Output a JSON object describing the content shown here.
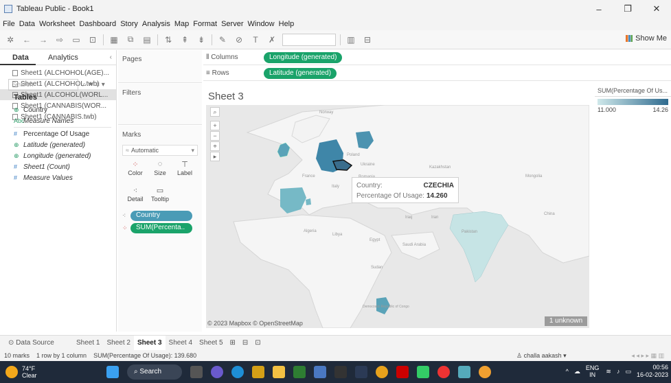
{
  "window": {
    "title": "Tableau Public - Book1",
    "controls": [
      "–",
      "❐",
      "✕"
    ]
  },
  "menu": [
    "File",
    "Data",
    "Worksheet",
    "Dashboard",
    "Story",
    "Analysis",
    "Map",
    "Format",
    "Server",
    "Window",
    "Help"
  ],
  "toolbar": {
    "show_me": "Show Me"
  },
  "data_pane": {
    "tabs": [
      "Data",
      "Analytics"
    ],
    "sources": [
      "Sheet1 (ALCHOHOL(AGE)...",
      "Sheet1 (ALCHOHOL.twb)",
      "Sheet1 (ALCOHOL(WORL...",
      "Sheet1 (CANNABIS(WOR...",
      "Sheet1 (CANNABIS.twb)"
    ],
    "selected_source": 2,
    "search_placeholder": "Search",
    "tables_label": "Tables",
    "fields": [
      {
        "icon": "⊕",
        "label": "Country",
        "kind": "dim",
        "italic": false
      },
      {
        "icon": "Abc",
        "label": "Measure Names",
        "kind": "dim",
        "italic": true
      },
      {
        "icon": "#",
        "label": "Percentage Of Usage",
        "kind": "meas",
        "italic": false
      },
      {
        "icon": "⊕",
        "label": "Latitude (generated)",
        "kind": "dim",
        "italic": true
      },
      {
        "icon": "⊕",
        "label": "Longitude (generated)",
        "kind": "dim",
        "italic": true
      },
      {
        "icon": "#",
        "label": "Sheet1 (Count)",
        "kind": "meas",
        "italic": true
      },
      {
        "icon": "#",
        "label": "Measure Values",
        "kind": "meas",
        "italic": true
      }
    ]
  },
  "cards": {
    "pages": "Pages",
    "filters": "Filters",
    "marks": "Marks",
    "mark_type": "Automatic",
    "mark_buttons": [
      "Color",
      "Size",
      "Label",
      "Detail",
      "Tooltip"
    ],
    "mark_fields": [
      "Country",
      "SUM(Percenta.."
    ]
  },
  "shelves": {
    "columns_label": "Columns",
    "columns_pill": "Longitude (generated)",
    "rows_label": "Rows",
    "rows_pill": "Latitude (generated)"
  },
  "view": {
    "sheet_title": "Sheet 3",
    "attribution": "© 2023 Mapbox © OpenStreetMap",
    "unknown": "1 unknown",
    "map_labels": [
      "Norway",
      "Poland",
      "Ukraine",
      "Kazakhstan",
      "Mongolia",
      "France",
      "Romania",
      "Italy",
      "Iraq",
      "Iran",
      "Algeria",
      "Libya",
      "Egypt",
      "Saudi Arabia",
      "Pakistan",
      "China",
      "Sudan",
      "Democratic Republic of Congo"
    ]
  },
  "tooltip": {
    "country_label": "Country:",
    "country_value": "CZECHIA",
    "usage_label": "Percentage Of Usage:",
    "usage_value": "14.260"
  },
  "legend": {
    "title": "SUM(Percentage Of Us...",
    "min": "11.000",
    "max": "14.26"
  },
  "colors": {
    "low": "#cfe8ea",
    "high": "#2f6b8f",
    "selected": "#3a6d8c",
    "green_pill": "#1aa36a",
    "blue_pill": "#4a9bb6"
  },
  "sheet_tabs": {
    "data_source": "Data Source",
    "tabs": [
      "Sheet 1",
      "Sheet 2",
      "Sheet 3",
      "Sheet 4",
      "Sheet 5"
    ],
    "active": 2
  },
  "status": {
    "marks": "10 marks",
    "rows": "1 row by 1 column",
    "sum": "SUM(Percentage Of Usage): 139.680",
    "user": "challa aakash"
  },
  "taskbar": {
    "temp": "74°F",
    "condition": "Clear",
    "search": "Search",
    "lang1": "ENG",
    "lang2": "IN",
    "time": "00:56",
    "date": "16-02-2023"
  }
}
